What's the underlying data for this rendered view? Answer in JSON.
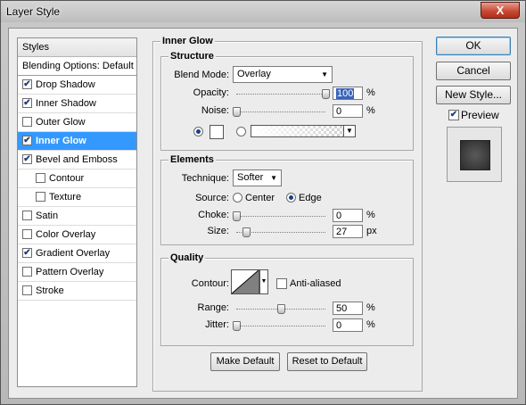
{
  "window": {
    "title": "Layer Style",
    "close_glyph": "X"
  },
  "styles_list": {
    "header": "Styles",
    "items": [
      {
        "label": "Blending Options: Default",
        "checkbox": false,
        "checked": false,
        "indent": false,
        "selected": false
      },
      {
        "label": "Drop Shadow",
        "checkbox": true,
        "checked": true,
        "indent": false,
        "selected": false
      },
      {
        "label": "Inner Shadow",
        "checkbox": true,
        "checked": true,
        "indent": false,
        "selected": false
      },
      {
        "label": "Outer Glow",
        "checkbox": true,
        "checked": false,
        "indent": false,
        "selected": false
      },
      {
        "label": "Inner Glow",
        "checkbox": true,
        "checked": true,
        "indent": false,
        "selected": true
      },
      {
        "label": "Bevel and Emboss",
        "checkbox": true,
        "checked": true,
        "indent": false,
        "selected": false
      },
      {
        "label": "Contour",
        "checkbox": true,
        "checked": false,
        "indent": true,
        "selected": false
      },
      {
        "label": "Texture",
        "checkbox": true,
        "checked": false,
        "indent": true,
        "selected": false
      },
      {
        "label": "Satin",
        "checkbox": true,
        "checked": false,
        "indent": false,
        "selected": false
      },
      {
        "label": "Color Overlay",
        "checkbox": true,
        "checked": false,
        "indent": false,
        "selected": false
      },
      {
        "label": "Gradient Overlay",
        "checkbox": true,
        "checked": true,
        "indent": false,
        "selected": false
      },
      {
        "label": "Pattern Overlay",
        "checkbox": true,
        "checked": false,
        "indent": false,
        "selected": false
      },
      {
        "label": "Stroke",
        "checkbox": true,
        "checked": false,
        "indent": false,
        "selected": false
      }
    ]
  },
  "inner_glow": {
    "title": "Inner Glow",
    "structure": {
      "title": "Structure",
      "blend_mode_label": "Blend Mode:",
      "blend_mode_value": "Overlay",
      "opacity_label": "Opacity:",
      "opacity_value": "100",
      "opacity_unit": "%",
      "opacity_level": 1.0,
      "noise_label": "Noise:",
      "noise_value": "0",
      "noise_unit": "%",
      "noise_level": 0.0,
      "color_swatch": "#ffffff"
    },
    "elements": {
      "title": "Elements",
      "technique_label": "Technique:",
      "technique_value": "Softer",
      "source_label": "Source:",
      "source_center": "Center",
      "source_edge": "Edge",
      "source_selected": "Edge",
      "choke_label": "Choke:",
      "choke_value": "0",
      "choke_unit": "%",
      "choke_level": 0.0,
      "size_label": "Size:",
      "size_value": "27",
      "size_unit": "px",
      "size_level": 0.108
    },
    "quality": {
      "title": "Quality",
      "contour_label": "Contour:",
      "anti_aliased_label": "Anti-aliased",
      "anti_aliased": false,
      "range_label": "Range:",
      "range_value": "50",
      "range_unit": "%",
      "range_level": 0.5,
      "jitter_label": "Jitter:",
      "jitter_value": "0",
      "jitter_unit": "%",
      "jitter_level": 0.0
    },
    "make_default": "Make Default",
    "reset_default": "Reset to Default"
  },
  "actions": {
    "ok": "OK",
    "cancel": "Cancel",
    "new_style": "New Style...",
    "preview_label": "Preview",
    "preview_checked": true
  },
  "icons": {
    "dropdown": "chevron-down-icon",
    "close": "close-icon"
  },
  "colors": {
    "selection": "#3399ff",
    "value_highlight": "#3a64b8",
    "close_button": "#c84a36"
  }
}
